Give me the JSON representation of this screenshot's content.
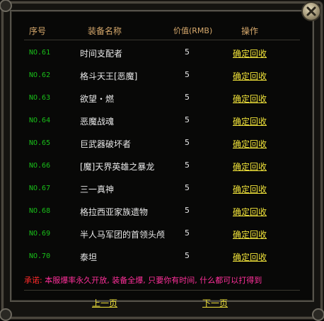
{
  "window": {
    "close_icon": "close-x-icon"
  },
  "columns": {
    "index": "序号",
    "name": "装备名称",
    "value": "价值(RMB)",
    "action": "操作"
  },
  "items": [
    {
      "index": "NO.61",
      "name": "时间支配者",
      "value": "5",
      "action": "确定回收"
    },
    {
      "index": "NO.62",
      "name": "格斗天王[恶魔]",
      "value": "5",
      "action": "确定回收"
    },
    {
      "index": "NO.63",
      "name": "欲望・燃",
      "value": "5",
      "action": "确定回收"
    },
    {
      "index": "NO.64",
      "name": "恶魔战魂",
      "value": "5",
      "action": "确定回收"
    },
    {
      "index": "NO.65",
      "name": "巨武器破坏者",
      "value": "5",
      "action": "确定回收"
    },
    {
      "index": "NO.66",
      "name": "[魔]天界英雄之暴龙",
      "value": "5",
      "action": "确定回收"
    },
    {
      "index": "NO.67",
      "name": "三一真神",
      "value": "5",
      "action": "确定回收"
    },
    {
      "index": "NO.68",
      "name": "格拉西亚家族遗物",
      "value": "5",
      "action": "确定回收"
    },
    {
      "index": "NO.69",
      "name": "半人马军团的首领头颅",
      "value": "5",
      "action": "确定回收"
    },
    {
      "index": "NO.70",
      "name": "泰坦",
      "value": "5",
      "action": "确定回收"
    }
  ],
  "notice": {
    "label": "承诺:",
    "text": "本服爆率永久开放, 装备全爆, 只要你有时间, 什么都可以打得到"
  },
  "pager": {
    "prev": "上一页",
    "next": "下一页"
  },
  "colors": {
    "index_green": "#19c019",
    "action_yellow": "#f1e33a",
    "header_gold": "#d7a96c",
    "notice_pink": "#ff2f9a"
  }
}
